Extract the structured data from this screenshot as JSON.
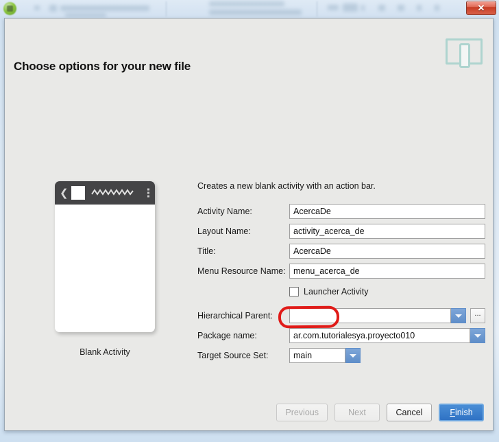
{
  "window": {
    "app_icon": "android-studio-icon",
    "close_label": "✕"
  },
  "dialog": {
    "title": "Choose options for your new file",
    "header_icon": "tablet-phone-icon"
  },
  "preview": {
    "caption": "Blank Activity",
    "action_bar": {
      "back_icon": "❮",
      "overflow_icon": "overflow-menu-icon"
    }
  },
  "form": {
    "description": "Creates a new blank activity with an action bar.",
    "fields": [
      {
        "label": "Activity Name:",
        "value": "AcercaDe",
        "type": "text",
        "highlighted": true
      },
      {
        "label": "Layout Name:",
        "value": "activity_acerca_de",
        "type": "text"
      },
      {
        "label": "Title:",
        "value": "AcercaDe",
        "type": "text"
      },
      {
        "label": "Menu Resource Name:",
        "value": "menu_acerca_de",
        "type": "text"
      }
    ],
    "checkbox": {
      "label": "Launcher Activity",
      "checked": false
    },
    "hierarchical_parent": {
      "label": "Hierarchical Parent:",
      "value": "",
      "browse_label": "..."
    },
    "package_name": {
      "label": "Package name:",
      "value": "ar.com.tutorialesya.proyecto010"
    },
    "target_source_set": {
      "label": "Target Source Set:",
      "value": "main"
    }
  },
  "footer": {
    "previous": "Previous",
    "next": "Next",
    "cancel": "Cancel",
    "finish_prefix": "F",
    "finish_rest": "inish"
  },
  "colors": {
    "accent": "#2f72c4",
    "annotation": "#e01b18",
    "dialog_bg": "#e9e9e7",
    "action_bar": "#444446",
    "header_icon": "#aed4cf"
  }
}
